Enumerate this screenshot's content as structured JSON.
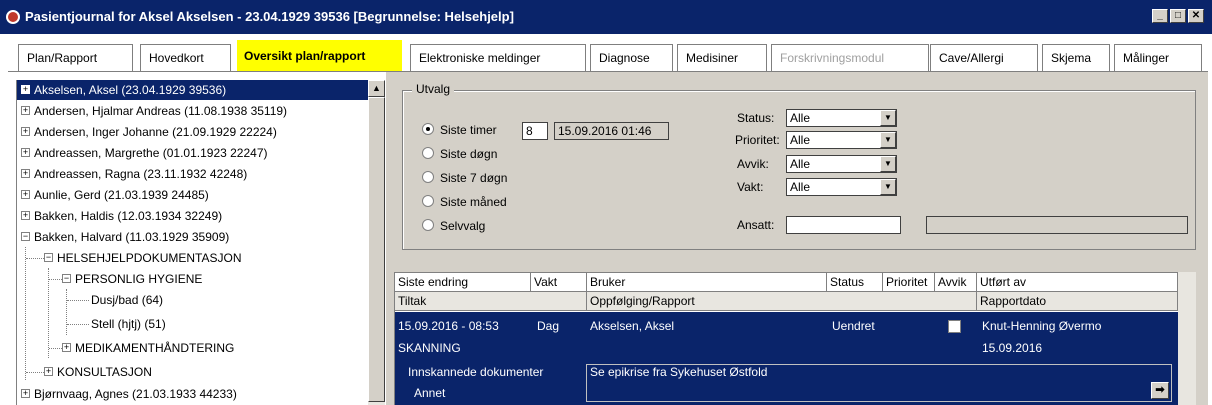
{
  "window": {
    "title": "Pasientjournal for Aksel Akselsen - 23.04.1929 39536  [Begrunnelse: Helsehjelp]",
    "minimize": "_",
    "restore": "□",
    "close": "✕"
  },
  "tabs": [
    {
      "label": "Plan/Rapport"
    },
    {
      "label": "Hovedkort"
    },
    {
      "label": "Oversikt plan/rapport"
    },
    {
      "label": "Elektroniske meldinger"
    },
    {
      "label": "Diagnose"
    },
    {
      "label": "Medisiner"
    },
    {
      "label": "Forskrivningsmodul"
    },
    {
      "label": "Cave/Allergi"
    },
    {
      "label": "Skjema"
    },
    {
      "label": "Målinger"
    }
  ],
  "tree": {
    "items": [
      {
        "label": "Akselsen, Aksel (23.04.1929 39536)"
      },
      {
        "label": "Andersen, Hjalmar Andreas (11.08.1938 35119)"
      },
      {
        "label": "Andersen, Inger Johanne (21.09.1929 22224)"
      },
      {
        "label": "Andreassen, Margrethe (01.01.1923 22247)"
      },
      {
        "label": "Andreassen, Ragna (23.11.1932 42248)"
      },
      {
        "label": "Aunlie, Gerd (21.03.1939 24485)"
      },
      {
        "label": "Bakken, Haldis (12.03.1934 32249)"
      },
      {
        "label": "Bakken, Halvard (11.03.1929 35909)"
      },
      {
        "label": "HELSEHJELPDOKUMENTASJON"
      },
      {
        "label": "PERSONLIG HYGIENE"
      },
      {
        "label": "Dusj/bad (64)"
      },
      {
        "label": "Stell (hjtj) (51)"
      },
      {
        "label": "MEDIKAMENTHÅNDTERING"
      },
      {
        "label": "KONSULTASJON"
      },
      {
        "label": "Bjørnvaag, Agnes (21.03.1933 44233)"
      }
    ]
  },
  "utvalg": {
    "legend": "Utvalg",
    "radios": [
      {
        "label": "Siste timer",
        "checked": true
      },
      {
        "label": "Siste døgn",
        "checked": false
      },
      {
        "label": "Siste 7 døgn",
        "checked": false
      },
      {
        "label": "Siste måned",
        "checked": false
      },
      {
        "label": "Selvvalg",
        "checked": false
      }
    ],
    "hours_value": "8",
    "since_value": "15.09.2016 01:46",
    "status_label": "Status:",
    "status_value": "Alle",
    "prioritet_label": "Prioritet:",
    "prioritet_value": "Alle",
    "avvik_label": "Avvik:",
    "avvik_value": "Alle",
    "vakt_label": "Vakt:",
    "vakt_value": "Alle",
    "ansatt_label": "Ansatt:",
    "ansatt_value": "",
    "ansatt_name_value": ""
  },
  "grid": {
    "headers1": [
      "Siste endring",
      "Vakt",
      "Bruker",
      "Status",
      "Prioritet",
      "Avvik",
      "Utført av"
    ],
    "headers2": [
      "Tiltak",
      "Oppfølging/Rapport",
      "Rapportdato"
    ],
    "row": {
      "time": "15.09.2016 - 08:53",
      "vakt": "Dag",
      "bruker": "Akselsen, Aksel",
      "status": "Uendret",
      "avvik_checked": false,
      "utfort_av": "Knut-Henning Øvermo",
      "tiltak": "SKANNING",
      "rapportdato": "15.09.2016",
      "tiltak_detail": "Innskannede dokumenter",
      "tiltak_sub": "Annet",
      "note": "Se epikrise fra Sykehuset Østfold"
    }
  },
  "icons": {
    "app": "app-logo-icon",
    "expand": "plus-box-icon",
    "collapse": "minus-box-icon",
    "scroll_up": "arrow-up-icon",
    "dropdown": "chevron-down-icon",
    "open": "arrow-right-icon"
  }
}
